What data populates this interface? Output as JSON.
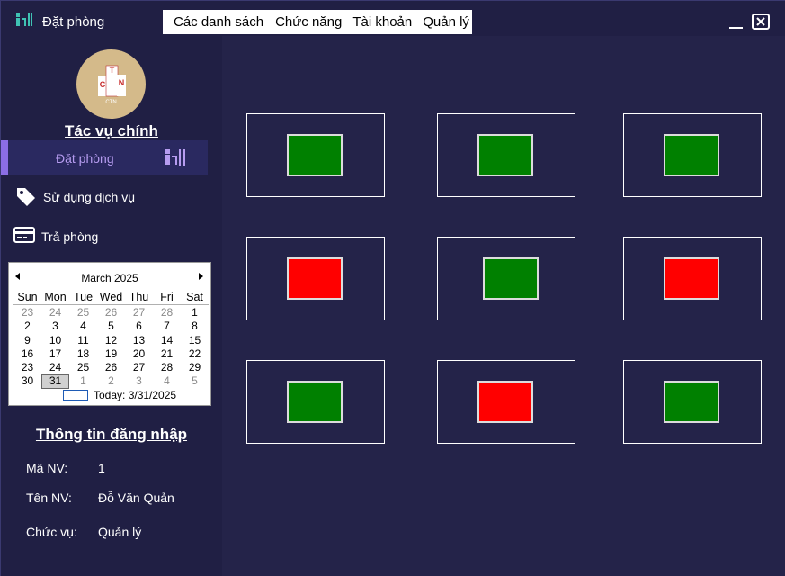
{
  "window": {
    "title": "Đặt phòng",
    "menu": [
      "Các danh sách",
      "Chức năng",
      "Tài khoản",
      "Quản lý"
    ]
  },
  "logo": {
    "text_top": "T",
    "text_left": "C",
    "text_right": "N",
    "caption": "CTN"
  },
  "sidebar": {
    "section_title": "Tác vụ chính",
    "nav": [
      {
        "label": "Đặt phòng",
        "icon": "booking-icon",
        "active": true
      },
      {
        "label": "Sử dụng dịch vụ",
        "icon": "tag-icon",
        "active": false
      },
      {
        "label": "Trả phòng",
        "icon": "payment-card-icon",
        "active": false
      }
    ]
  },
  "calendar": {
    "month_label": "March 2025",
    "weekdays": [
      "Sun",
      "Mon",
      "Tue",
      "Wed",
      "Thu",
      "Fri",
      "Sat"
    ],
    "weeks": [
      [
        {
          "d": "23",
          "dim": true
        },
        {
          "d": "24",
          "dim": true
        },
        {
          "d": "25",
          "dim": true
        },
        {
          "d": "26",
          "dim": true
        },
        {
          "d": "27",
          "dim": true
        },
        {
          "d": "28",
          "dim": true
        },
        {
          "d": "1",
          "dim": false
        }
      ],
      [
        {
          "d": "2",
          "dim": false
        },
        {
          "d": "3",
          "dim": false
        },
        {
          "d": "4",
          "dim": false
        },
        {
          "d": "5",
          "dim": false
        },
        {
          "d": "6",
          "dim": false
        },
        {
          "d": "7",
          "dim": false
        },
        {
          "d": "8",
          "dim": false
        }
      ],
      [
        {
          "d": "9",
          "dim": false
        },
        {
          "d": "10",
          "dim": false
        },
        {
          "d": "11",
          "dim": false
        },
        {
          "d": "12",
          "dim": false
        },
        {
          "d": "13",
          "dim": false
        },
        {
          "d": "14",
          "dim": false
        },
        {
          "d": "15",
          "dim": false
        }
      ],
      [
        {
          "d": "16",
          "dim": false
        },
        {
          "d": "17",
          "dim": false
        },
        {
          "d": "18",
          "dim": false
        },
        {
          "d": "19",
          "dim": false
        },
        {
          "d": "20",
          "dim": false
        },
        {
          "d": "21",
          "dim": false
        },
        {
          "d": "22",
          "dim": false
        }
      ],
      [
        {
          "d": "23",
          "dim": false
        },
        {
          "d": "24",
          "dim": false
        },
        {
          "d": "25",
          "dim": false
        },
        {
          "d": "26",
          "dim": false
        },
        {
          "d": "27",
          "dim": false
        },
        {
          "d": "28",
          "dim": false
        },
        {
          "d": "29",
          "dim": false
        }
      ],
      [
        {
          "d": "30",
          "dim": false
        },
        {
          "d": "31",
          "dim": false,
          "selected": true
        },
        {
          "d": "1",
          "dim": true
        },
        {
          "d": "2",
          "dim": true
        },
        {
          "d": "3",
          "dim": true
        },
        {
          "d": "4",
          "dim": true
        },
        {
          "d": "5",
          "dim": true
        }
      ]
    ],
    "today_label": "Today: 3/31/2025"
  },
  "login_info": {
    "title": "Thông tin đăng nhập",
    "rows": [
      {
        "label": "Mã NV:",
        "value": "1"
      },
      {
        "label": "Tên NV:",
        "value": "Đỗ Văn Quản"
      },
      {
        "label": "Chức vụ:",
        "value": "Quản lý"
      }
    ]
  },
  "rooms": [
    {
      "status": "green"
    },
    {
      "status": "green"
    },
    {
      "status": "green"
    },
    {
      "status": "red"
    },
    {
      "status": "green"
    },
    {
      "status": "red"
    },
    {
      "status": "green"
    },
    {
      "status": "red"
    },
    {
      "status": "green"
    }
  ],
  "colors": {
    "background": "#242349",
    "sidebar": "#201f44",
    "accent": "#8b6ee5",
    "available": "#008000",
    "occupied": "#ff0000"
  }
}
